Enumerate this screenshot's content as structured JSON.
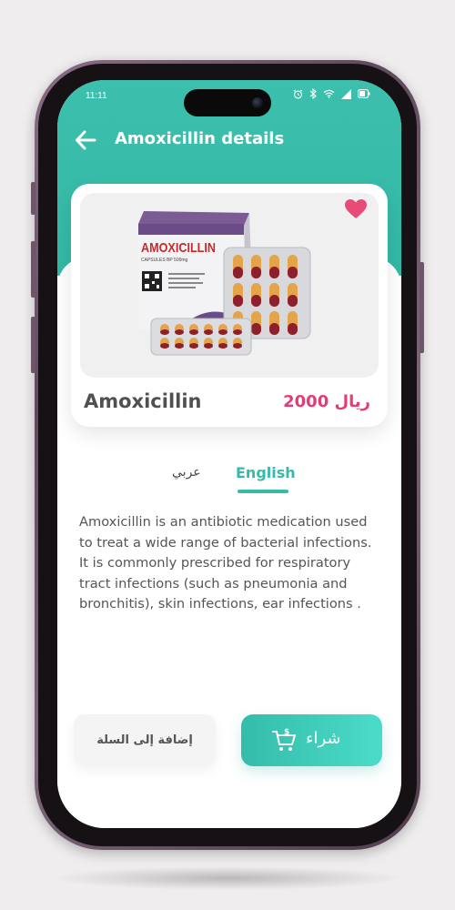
{
  "status_bar": {
    "time": "11:11",
    "icons": [
      "alarm-icon",
      "bluetooth-icon",
      "wifi-icon",
      "signal-icon",
      "battery-icon"
    ]
  },
  "header": {
    "title": "Amoxicillin details",
    "back_icon": "arrow-left-icon"
  },
  "product": {
    "name": "Amoxicillin",
    "price": "2000 ريال",
    "favorite": true,
    "image_text": {
      "brand": "AMOXICILLIN",
      "subtitle": "CAPSULES BP 500mg"
    }
  },
  "language_tabs": {
    "tabs": [
      {
        "label": "عربي",
        "active": false
      },
      {
        "label": "English",
        "active": true
      }
    ]
  },
  "description": "Amoxicillin is an antibiotic medication used to treat a wide range of bacterial infections. It is commonly prescribed for respiratory tract infections (such as pneumonia and bronchitis), skin infections, ear infections .",
  "actions": {
    "add_to_cart": "إضافة إلى السلة",
    "buy": "شراء",
    "buy_icon": "cart-dollar-icon"
  },
  "colors": {
    "primary": "#35bba8",
    "price": "#e33d75",
    "heart": "#e94a76"
  }
}
